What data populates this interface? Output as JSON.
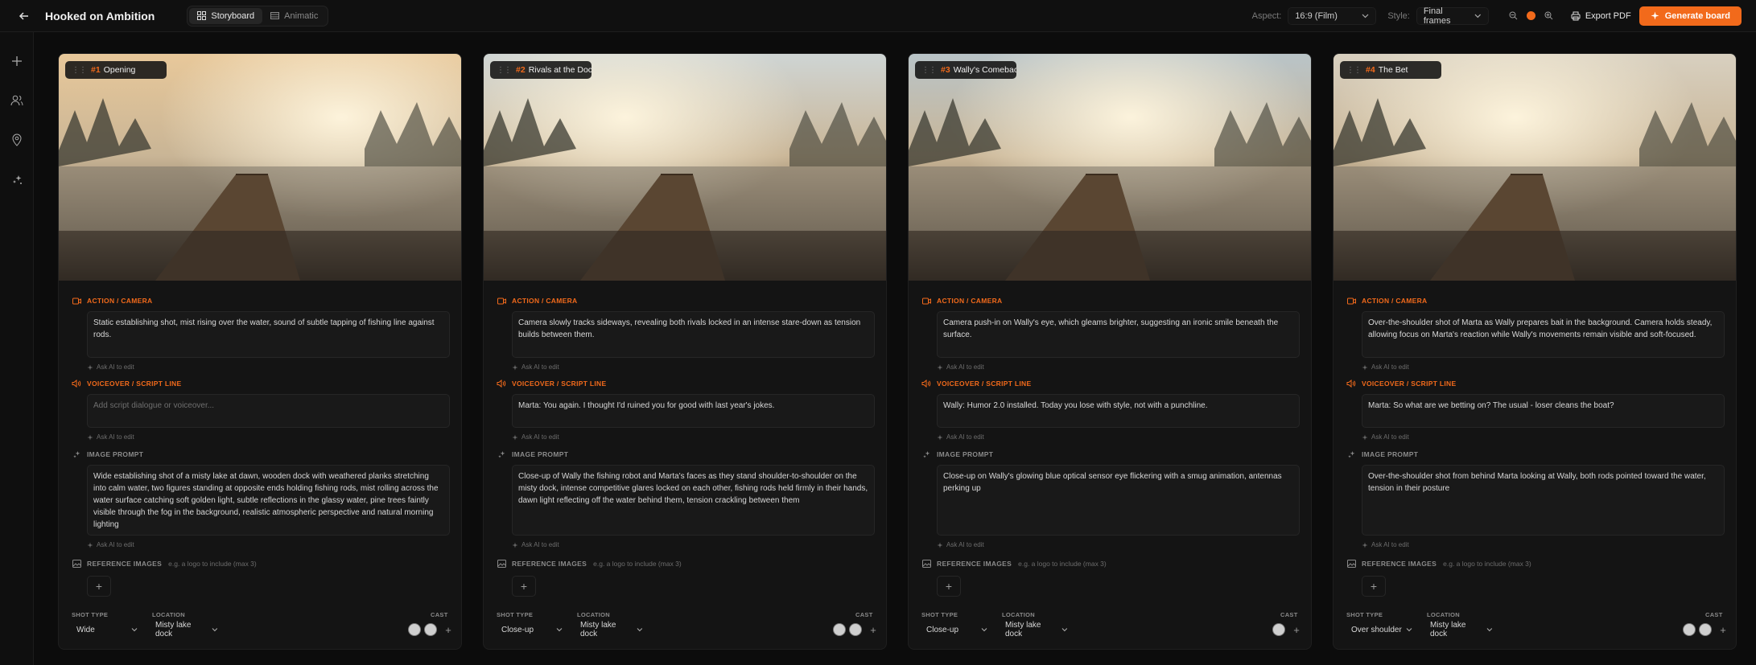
{
  "app": {
    "title": "Hooked on Ambition",
    "tabs": [
      {
        "label": "Storyboard",
        "active": true
      },
      {
        "label": "Animatic",
        "active": false
      }
    ],
    "aspect_label": "Aspect:",
    "aspect_value": "16:9 (Film)",
    "style_label": "Style:",
    "style_value": "Final frames",
    "export_label": "Export PDF",
    "generate_label": "Generate board",
    "accent_color": "#f26a1b"
  },
  "labels": {
    "action_camera": "ACTION / CAMERA",
    "voiceover": "VOICEOVER / SCRIPT LINE",
    "image_prompt": "IMAGE PROMPT",
    "reference_images": "REFERENCE IMAGES",
    "reference_hint": "e.g. a logo to include (max 3)",
    "ask_ai": "Ask AI to edit",
    "shot_type": "SHOT TYPE",
    "location": "LOCATION",
    "cast": "CAST",
    "voiceover_placeholder": "Add script dialogue or voiceover..."
  },
  "shots": [
    {
      "number": "#1",
      "title": "Opening",
      "action": "Static establishing shot, mist rising over the water, sound of subtle tapping of fishing line against rods.",
      "voiceover": "",
      "image_prompt": "Wide establishing shot of a misty lake at dawn, wooden dock with weathered planks stretching into calm water, two figures standing at opposite ends holding fishing rods, mist rolling across the water surface catching soft golden light, subtle reflections in the glassy water, pine trees faintly visible through the fog in the background, realistic atmospheric perspective and natural morning lighting",
      "shot_type": "Wide",
      "location": "Misty lake dock",
      "cast_count": 2
    },
    {
      "number": "#2",
      "title": "Rivals at the Dock",
      "action": "Camera slowly tracks sideways, revealing both rivals locked in an intense stare-down as tension builds between them.",
      "voiceover": "Marta: You again. I thought I'd ruined you for good with last year's jokes.",
      "image_prompt": "Close-up of Wally the fishing robot and Marta's faces as they stand shoulder-to-shoulder on the misty dock, intense competitive glares locked on each other, fishing rods held firmly in their hands, dawn light reflecting off the water behind them, tension crackling between them",
      "shot_type": "Close-up",
      "location": "Misty lake dock",
      "cast_count": 2
    },
    {
      "number": "#3",
      "title": "Wally's Comeback",
      "action": "Camera push-in on Wally's eye, which gleams brighter, suggesting an ironic smile beneath the surface.",
      "voiceover": "Wally: Humor 2.0 installed. Today you lose with style, not with a punchline.",
      "image_prompt": "Close-up on Wally's glowing blue optical sensor eye flickering with a smug animation, antennas perking up",
      "shot_type": "Close-up",
      "location": "Misty lake dock",
      "cast_count": 1
    },
    {
      "number": "#4",
      "title": "The Bet",
      "action": "Over-the-shoulder shot of Marta as Wally prepares bait in the background. Camera holds steady, allowing focus on Marta's reaction while Wally's movements remain visible and soft-focused.",
      "voiceover": "Marta: So what are we betting on? The usual - loser cleans the boat?",
      "image_prompt": "Over-the-shoulder shot from behind Marta looking at Wally, both rods pointed toward the water, tension in their posture",
      "shot_type": "Over shoulder",
      "location": "Misty lake dock",
      "cast_count": 2
    }
  ]
}
